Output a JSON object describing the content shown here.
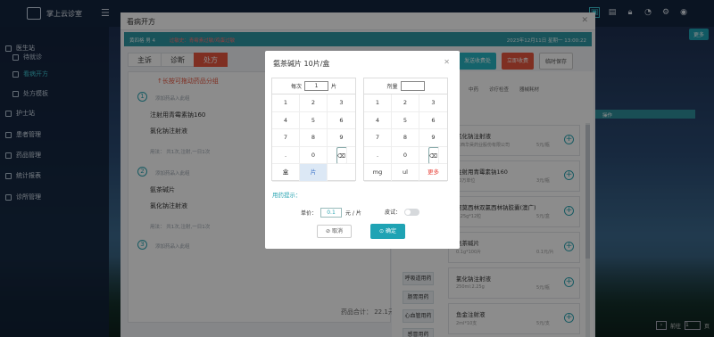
{
  "app": {
    "title": "掌上云诊室"
  },
  "sidebar": {
    "items": [
      {
        "label": "医生站",
        "level": 1
      },
      {
        "label": "待就诊",
        "level": 2
      },
      {
        "label": "看病开方",
        "level": 2
      },
      {
        "label": "处方模板",
        "level": 2
      },
      {
        "label": "护士站",
        "level": 1
      },
      {
        "label": "患者管理",
        "level": 1
      },
      {
        "label": "药品管理",
        "level": 1
      },
      {
        "label": "统计报表",
        "level": 1
      },
      {
        "label": "诊所管理",
        "level": 1
      }
    ]
  },
  "topbar": {
    "more_label": "更多"
  },
  "main_dialog": {
    "title": "看病开方",
    "patient_bar": {
      "left": "黄四格 男 4",
      "warning": "过敏史：青霉素过敏/鸡蛋过敏",
      "date": "2023年12月11日 星期一 13:00:22"
    },
    "tabs": [
      "主诉",
      "诊断",
      "处方"
    ],
    "right_buttons": [
      "发送收费处",
      "立即收费",
      "临时保存"
    ],
    "rx_hint": "↑长按可拖动药品分组",
    "groups": [
      {
        "num": "1",
        "add_label": "添加药品入此组",
        "drugs": [
          {
            "name": "注射用青霉素钠160",
            "qty": "4瓶"
          },
          {
            "name": "氯化钠注射液",
            "qty": "1瓶"
          }
        ],
        "usage": "用法：  共1次,注射,一日1次"
      },
      {
        "num": "2",
        "add_label": "添加药品入此组",
        "drugs": [
          {
            "name": "氨茶碱片",
            "qty": "1片"
          },
          {
            "name": "氯化钠注射液",
            "qty": "1瓶"
          }
        ],
        "usage": "用法：  共1次,注射,一日1次"
      },
      {
        "num": "3",
        "add_label": "添加药品入此组"
      }
    ],
    "total_label": "药品合计：  22.1元",
    "drug_tabs": [
      "中药",
      "诊疗检查",
      "器械耗材"
    ],
    "categories": [
      "呼吸道用药",
      "肠胃用药",
      "心血管用药",
      "感冒用药"
    ],
    "drug_cards": [
      {
        "name": "氯化钠注射液",
        "spec": "江西华昊药业股份有限公司",
        "price": "5元/瓶"
      },
      {
        "name": "注射用青霉素钠160",
        "spec": "80万单位",
        "price": "3元/瓶"
      },
      {
        "name": "阿莫西林双氯西林钠胶囊(澳广)",
        "spec": "0.25g*12粒",
        "price": "5元/盒"
      },
      {
        "name": "氨茶碱片",
        "spec": "0.1g*100片",
        "price": "0.1元/片"
      },
      {
        "name": "氯化钠注射液",
        "spec": "250ml:2.25g",
        "price": "5元/瓶"
      },
      {
        "name": "鱼金注射液",
        "spec": "2ml*10支",
        "price": "5元/支"
      }
    ]
  },
  "op_header": "操作",
  "pager": {
    "goto_label": "前往",
    "page": "1",
    "page_suffix": "页"
  },
  "modal": {
    "title": "氨茶碱片  10片/盒",
    "left_pad": {
      "per_label": "每次",
      "per_value": "1",
      "per_unit": "片",
      "keys": [
        "1",
        "2",
        "3",
        "4",
        "5",
        "6",
        "7",
        "8",
        "9",
        ".",
        "0",
        "⌫"
      ],
      "units": [
        "盒",
        "片"
      ]
    },
    "right_pad": {
      "dose_label": "剂量",
      "dose_value": "",
      "keys": [
        "1",
        "2",
        "3",
        "4",
        "5",
        "6",
        "7",
        "8",
        "9",
        ".",
        "0",
        "⌫"
      ],
      "units": [
        "mg",
        "ul",
        "更多"
      ]
    },
    "hint_label": "用药提示：",
    "price_label": "单价：",
    "price_value": "0.1",
    "price_unit": "元 / 片",
    "skin_test_label": "皮试：",
    "skin_test_on": false,
    "cancel_label": "取消",
    "ok_label": "确定"
  },
  "colors": {
    "accent": "#1fa3b4",
    "danger": "#e8563f",
    "sidebar": "#12223a"
  }
}
